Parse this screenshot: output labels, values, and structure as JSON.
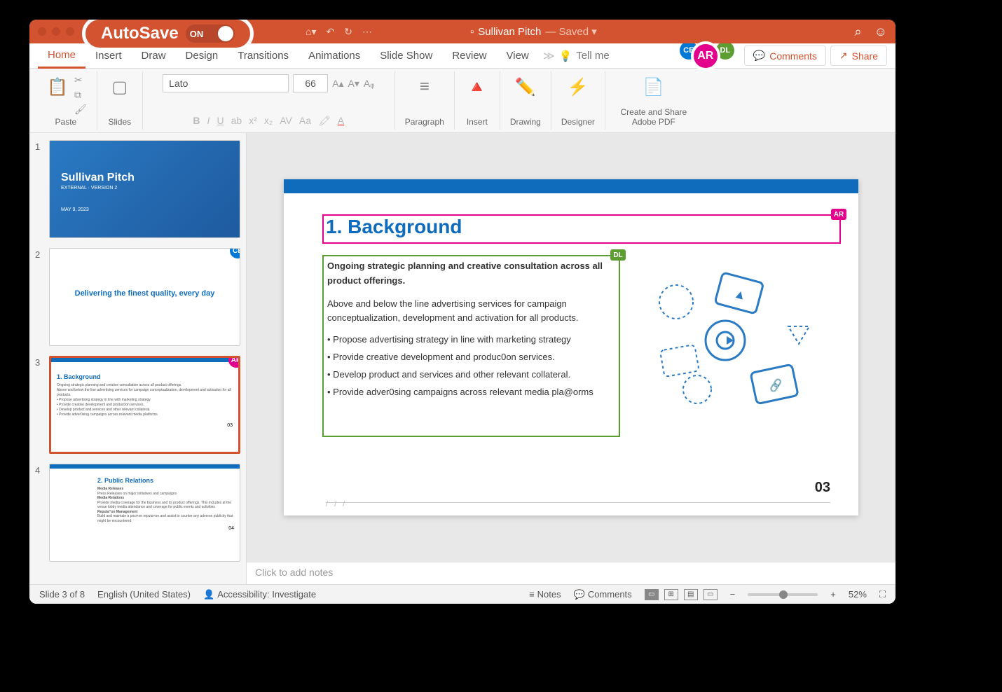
{
  "autosave": {
    "label": "AutoSave",
    "state": "ON"
  },
  "document": {
    "name": "Sullivan Pitch",
    "status": "Saved"
  },
  "tabs": [
    "Home",
    "Insert",
    "Draw",
    "Design",
    "Transitions",
    "Animations",
    "Slide Show",
    "Review",
    "View"
  ],
  "active_tab": "Home",
  "tell_me": "Tell me",
  "collaborators": [
    {
      "initials": "CE",
      "color": "#0078d4"
    },
    {
      "initials": "AR",
      "color": "#e3008c"
    },
    {
      "initials": "DL",
      "color": "#5c9e31"
    }
  ],
  "actions": {
    "comments": "Comments",
    "share": "Share"
  },
  "ribbon": {
    "paste": "Paste",
    "slides": "Slides",
    "font_name": "Lato",
    "font_size": "66",
    "paragraph": "Paragraph",
    "insert": "Insert",
    "drawing": "Drawing",
    "designer": "Designer",
    "adobe": "Create and Share Adobe PDF"
  },
  "thumbnails": [
    {
      "num": "1",
      "title": "Sullivan Pitch",
      "sub": "EXTERNAL · VERSION 2",
      "date": "MAY 9, 2023"
    },
    {
      "num": "2",
      "text": "Delivering the finest quality, every day",
      "badge": "CE",
      "badge_color": "#0078d4"
    },
    {
      "num": "3",
      "title": "1. Background",
      "badge": "AR",
      "badge_color": "#e3008c",
      "selected": true,
      "page": "03"
    },
    {
      "num": "4",
      "title": "2. Public Relations",
      "page": "04"
    }
  ],
  "slide": {
    "title": "1. Background",
    "lead": "Ongoing strategic planning and creative consultation across all product offerings.",
    "para": "Above and below the line advertising services for campaign conceptualization, development and activation for all products.",
    "bullets": [
      "Propose advertising strategy in line with marketing strategy",
      "Provide creative development and produc0on services.",
      "Develop product and services and other relevant collateral.",
      "Provide adver0sing campaigns across relevant media pla@orms"
    ],
    "page_num": "03",
    "sel_ar": "AR",
    "sel_dl": "DL"
  },
  "notes_placeholder": "Click to add notes",
  "status": {
    "slide": "Slide 3 of 8",
    "lang": "English (United States)",
    "accessibility": "Accessibility: Investigate",
    "notes": "Notes",
    "comments": "Comments",
    "zoom": "52%"
  }
}
